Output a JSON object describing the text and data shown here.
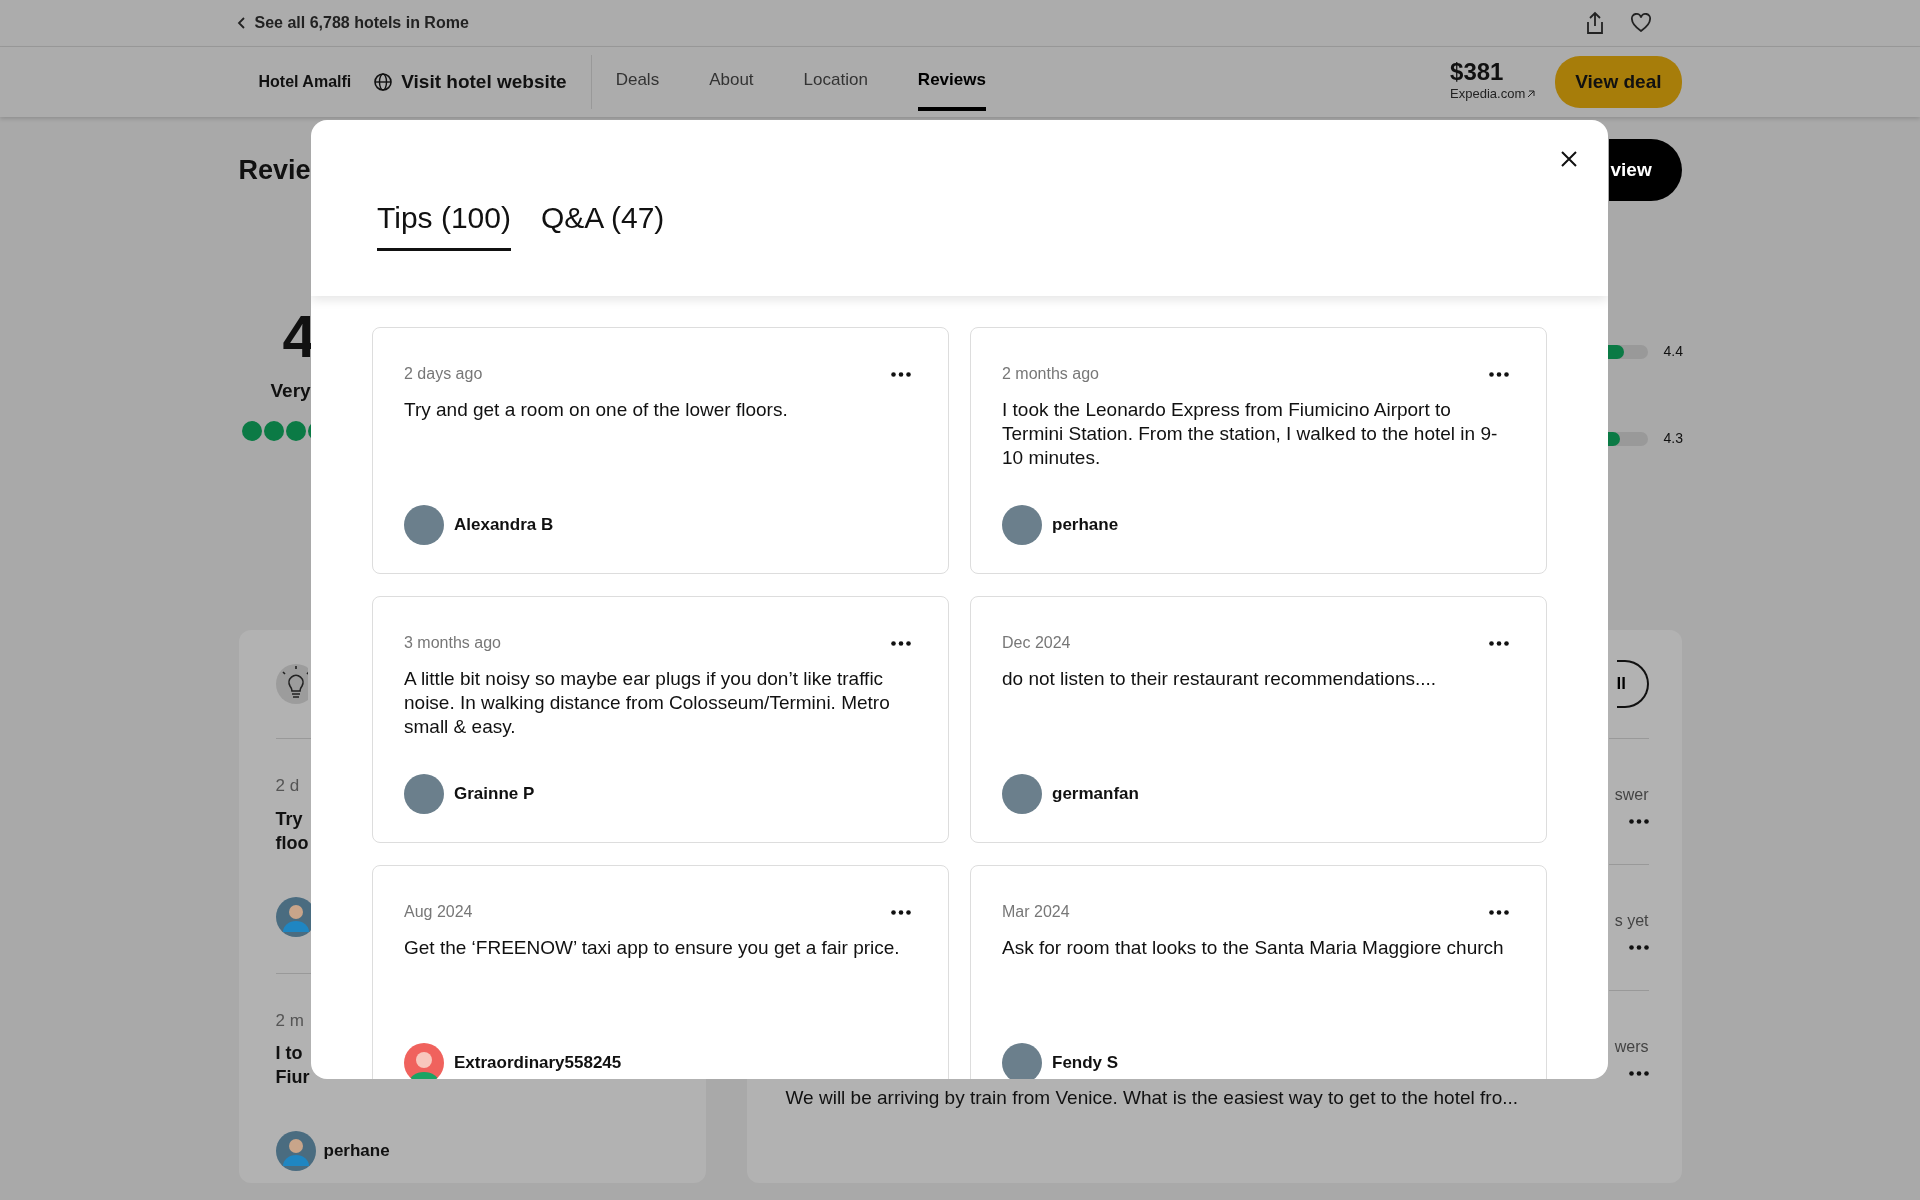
{
  "top_bar": {
    "back_link": "See all 6,788 hotels in Rome"
  },
  "hotel_nav": {
    "hotel_name": "Hotel Amalfi",
    "website_link": "Visit hotel website",
    "tabs": [
      {
        "label": "Deals",
        "selected": false
      },
      {
        "label": "About",
        "selected": false
      },
      {
        "label": "Location",
        "selected": false
      },
      {
        "label": "Reviews",
        "selected": true
      }
    ],
    "price": "$381",
    "provider": "Expedia.com",
    "deal_button": "View deal"
  },
  "reviews_section": {
    "heading": "Revie",
    "write_button": "view",
    "score": "4",
    "rating_word": "Very",
    "bars": [
      {
        "level": 0.88,
        "reading": "4.4"
      },
      {
        "level": 0.86,
        "reading": "4.3"
      }
    ]
  },
  "tips_panel": {
    "items": [
      {
        "date": "2 d",
        "lines": [
          "Try",
          "floo"
        ]
      },
      {
        "date": "2 m",
        "lines": [
          "I to",
          "Fiur"
        ],
        "author": "perhane"
      }
    ]
  },
  "qa_panel": {
    "button": "ll",
    "items": [
      {
        "status": "swer"
      },
      {
        "status": "s yet"
      },
      {
        "status": "wers"
      }
    ],
    "question": "We will be arriving by train from Venice. What is the easiest way to get to the hotel fro..."
  },
  "modal": {
    "tabs": [
      {
        "label": "Tips (100)",
        "selected": true
      },
      {
        "label": "Q&A (47)",
        "selected": false
      }
    ],
    "tips": [
      {
        "date": "2 days ago",
        "text": "Try and get a room on one of the lower floors.",
        "author": "Alexandra B",
        "kind": "photo"
      },
      {
        "date": "2 months ago",
        "text": "I took the Leonardo Express from Fiumicino Airport to Termini Station. From the station, I walked to the hotel in 9-10 minutes.",
        "author": "perhane",
        "kind": "photo"
      },
      {
        "date": "3 months ago",
        "text": "A little bit noisy so maybe ear plugs if you don’t like traffic noise. In walking distance from Colosseum/Termini. Metro small & easy.",
        "author": "Grainne P",
        "kind": "photo"
      },
      {
        "date": "Dec 2024",
        "text": "do not listen to their restaurant recommendations....",
        "author": "germanfan",
        "kind": "photo"
      },
      {
        "date": "Aug 2024",
        "text": "Get the ‘FREENOW’ taxi app to ensure you get a fair price.",
        "author": "Extraordinary558245",
        "kind": "default"
      },
      {
        "date": "Mar 2024",
        "text": "Ask for room that looks to the Santa Maria Maggiore church",
        "author": "Fendy S",
        "kind": "photo"
      }
    ]
  }
}
